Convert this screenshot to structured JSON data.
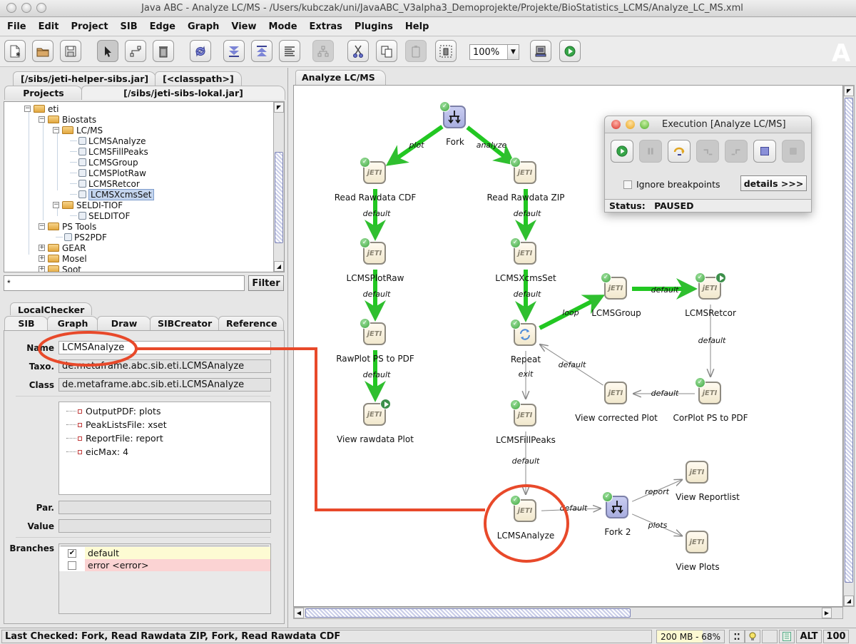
{
  "window": {
    "title": "Java ABC -  Analyze LC/MS - /Users/kubczak/uni/JavaABC_V3alpha3_Demoprojekte/Projekte/BioStatistics_LCMS/Analyze_LC_MS.xml"
  },
  "menubar": [
    "File",
    "Edit",
    "Project",
    "SIB",
    "Edge",
    "Graph",
    "View",
    "Mode",
    "Extras",
    "Plugins",
    "Help"
  ],
  "toolbar": {
    "buttons": [
      {
        "name": "new-file",
        "icon": "new-document-icon"
      },
      {
        "name": "open",
        "icon": "folder-open-icon"
      },
      {
        "name": "save",
        "icon": "floppy-disk-icon"
      },
      {
        "name": "select-mode",
        "icon": "arrow-pointer-icon",
        "pressed": true
      },
      {
        "name": "edge-mode",
        "icon": "connector-icon"
      },
      {
        "name": "delete",
        "icon": "trash-icon"
      },
      {
        "name": "refresh",
        "icon": "refresh-icon"
      },
      {
        "name": "collapse",
        "icon": "double-chevron-down-icon"
      },
      {
        "name": "expand",
        "icon": "double-chevron-up-icon"
      },
      {
        "name": "align",
        "icon": "align-text-icon"
      },
      {
        "name": "hierarchy",
        "icon": "hierarchy-icon",
        "disabled": true
      },
      {
        "name": "cut",
        "icon": "scissors-icon"
      },
      {
        "name": "copy",
        "icon": "copy-icon"
      },
      {
        "name": "paste",
        "icon": "clipboard-icon",
        "disabled": true
      },
      {
        "name": "delete-selection",
        "icon": "trash-dashed-icon"
      },
      {
        "name": "terminal",
        "icon": "computer-icon"
      },
      {
        "name": "run",
        "icon": "play-icon"
      }
    ],
    "zoom": "100%",
    "logo": "A"
  },
  "left_panel": {
    "tabs_row1": [
      "[/sibs/jeti-helper-sibs.jar]",
      "[<classpath>]"
    ],
    "tabs_row2": [
      "Projects",
      "[/sibs/jeti-sibs-lokal.jar]"
    ],
    "tree": [
      {
        "label": "eti",
        "type": "folder",
        "level": 0,
        "expanded": true
      },
      {
        "label": "Biostats",
        "type": "folder",
        "level": 1,
        "expanded": true
      },
      {
        "label": "LC/MS",
        "type": "folder",
        "level": 2,
        "expanded": true
      },
      {
        "label": "LCMSAnalyze",
        "type": "leaf",
        "level": 3
      },
      {
        "label": "LCMSFillPeaks",
        "type": "leaf",
        "level": 3
      },
      {
        "label": "LCMSGroup",
        "type": "leaf",
        "level": 3
      },
      {
        "label": "LCMSPlotRaw",
        "type": "leaf",
        "level": 3
      },
      {
        "label": "LCMSRetcor",
        "type": "leaf",
        "level": 3
      },
      {
        "label": "LCMSXcmsSet",
        "type": "leaf",
        "level": 3,
        "selected": true
      },
      {
        "label": "SELDI-TIOF",
        "type": "folder",
        "level": 2,
        "expanded": true
      },
      {
        "label": "SELDITOF",
        "type": "leaf",
        "level": 3
      },
      {
        "label": "PS Tools",
        "type": "folder",
        "level": 1,
        "expanded": true
      },
      {
        "label": "PS2PDF",
        "type": "leaf",
        "level": 2
      },
      {
        "label": "GEAR",
        "type": "folder",
        "level": 1,
        "expanded": false
      },
      {
        "label": "Mosel",
        "type": "folder",
        "level": 1,
        "expanded": false
      },
      {
        "label": "Soot",
        "type": "folder",
        "level": 1,
        "expanded": false
      }
    ],
    "filter": {
      "value": "*",
      "button": "Filter"
    },
    "inspector_tabs_row1": [
      "LocalChecker"
    ],
    "inspector_tabs_row2": [
      "SIB",
      "Graph",
      "Draw",
      "SIBCreator",
      "Reference"
    ],
    "sib": {
      "name_label": "Name",
      "name_value": "LCMSAnalyze",
      "taxo_label": "Taxo.",
      "taxo_value": "de.metaframe.abc.sib.eti.LCMSAnalyze",
      "class_label": "Class",
      "class_value": "de.metaframe.abc.sib.eti.LCMSAnalyze",
      "parameters": [
        "OutputPDF: plots",
        "PeakListsFile: xset",
        "ReportFile: report",
        "eicMax: 4"
      ],
      "par_label": "Par.",
      "par_value": "",
      "value_label": "Value",
      "value_value": "",
      "branches_label": "Branches",
      "branches": [
        {
          "label": "default",
          "checked": true,
          "color": "#fdfbd3"
        },
        {
          "label": "error  <error>",
          "checked": false,
          "color": "#fbd3d3"
        }
      ]
    }
  },
  "editor": {
    "tab": "Analyze LC/MS",
    "nodes": [
      {
        "id": "fork",
        "label": "Fork",
        "kind": "fork",
        "checked": true
      },
      {
        "id": "rrcdf",
        "label": "Read Rawdata CDF",
        "kind": "jeti",
        "checked": true
      },
      {
        "id": "rrzip",
        "label": "Read Rawdata ZIP",
        "kind": "jeti",
        "checked": true
      },
      {
        "id": "plotraw",
        "label": "LCMSPlotRaw",
        "kind": "jeti",
        "checked": true
      },
      {
        "id": "xcms",
        "label": "LCMSXcmsSet",
        "kind": "jeti",
        "checked": true
      },
      {
        "id": "rawpdf",
        "label": "RawPlot PS to PDF",
        "kind": "jeti",
        "checked": true
      },
      {
        "id": "repeat",
        "label": "Repeat",
        "kind": "repeat",
        "checked": true
      },
      {
        "id": "group",
        "label": "LCMSGroup",
        "kind": "jeti",
        "checked": true
      },
      {
        "id": "retcor",
        "label": "LCMSRetcor",
        "kind": "jeti",
        "checked": true,
        "current": true
      },
      {
        "id": "viewraw",
        "label": "View rawdata Plot",
        "kind": "jeti",
        "checked": false,
        "current": true
      },
      {
        "id": "fill",
        "label": "LCMSFillPeaks",
        "kind": "jeti",
        "checked": true
      },
      {
        "id": "viewcor",
        "label": "View corrected Plot",
        "kind": "jeti",
        "checked": false
      },
      {
        "id": "corpdf",
        "label": "CorPlot PS to PDF",
        "kind": "jeti",
        "checked": true
      },
      {
        "id": "analyze",
        "label": "LCMSAnalyze",
        "kind": "jeti",
        "checked": true,
        "highlighted": true
      },
      {
        "id": "fork2",
        "label": "Fork 2",
        "kind": "fork",
        "checked": true
      },
      {
        "id": "report",
        "label": "View Reportlist",
        "kind": "jeti",
        "checked": false
      },
      {
        "id": "plots",
        "label": "View Plots",
        "kind": "jeti",
        "checked": false
      }
    ],
    "edges": [
      {
        "from": "fork",
        "to": "rrcdf",
        "label": "plot",
        "executed": true
      },
      {
        "from": "fork",
        "to": "rrzip",
        "label": "analyze",
        "executed": true
      },
      {
        "from": "rrcdf",
        "to": "plotraw",
        "label": "default",
        "executed": true
      },
      {
        "from": "plotraw",
        "to": "rawpdf",
        "label": "default",
        "executed": true
      },
      {
        "from": "rawpdf",
        "to": "viewraw",
        "label": "default",
        "executed": true
      },
      {
        "from": "rrzip",
        "to": "xcms",
        "label": "default",
        "executed": true
      },
      {
        "from": "xcms",
        "to": "repeat",
        "label": "default",
        "executed": true
      },
      {
        "from": "repeat",
        "to": "group",
        "label": "loop",
        "executed": true
      },
      {
        "from": "group",
        "to": "retcor",
        "label": "default",
        "executed": true
      },
      {
        "from": "retcor",
        "to": "corpdf",
        "label": "default",
        "executed": false
      },
      {
        "from": "corpdf",
        "to": "viewcor",
        "label": "default",
        "executed": false
      },
      {
        "from": "viewcor",
        "to": "repeat",
        "label": "default",
        "executed": false
      },
      {
        "from": "repeat",
        "to": "fill",
        "label": "exit",
        "executed": false
      },
      {
        "from": "fill",
        "to": "analyze",
        "label": "default",
        "executed": false
      },
      {
        "from": "analyze",
        "to": "fork2",
        "label": "default",
        "executed": false
      },
      {
        "from": "fork2",
        "to": "report",
        "label": "report",
        "executed": false
      },
      {
        "from": "fork2",
        "to": "plots",
        "label": "plots",
        "executed": false
      }
    ],
    "node_text": "jETI"
  },
  "execution": {
    "title": "Execution [Analyze LC/MS]",
    "buttons": [
      {
        "name": "run",
        "icon": "play-icon",
        "disabled": false
      },
      {
        "name": "pause",
        "icon": "pause-icon",
        "disabled": true
      },
      {
        "name": "step-over",
        "icon": "step-over-icon",
        "disabled": false
      },
      {
        "name": "step-into",
        "icon": "step-into-icon",
        "disabled": true
      },
      {
        "name": "step-out",
        "icon": "step-out-icon",
        "disabled": true
      },
      {
        "name": "stop",
        "icon": "stop-icon",
        "disabled": false
      },
      {
        "name": "terminate",
        "icon": "terminate-icon",
        "disabled": true
      }
    ],
    "ignore_breakpoints": "Ignore breakpoints",
    "details": "details >>>",
    "status_label": "Status:",
    "status_value": "PAUSED"
  },
  "statusbar": {
    "message": "Last Checked: Fork, Read Rawdata ZIP, Fork, Read Rawdata CDF",
    "memory": "200 MB - 68%",
    "memory_fraction": 0.68,
    "alt": "ALT",
    "value": "100"
  },
  "annotation": {
    "color": "#e8492a"
  }
}
